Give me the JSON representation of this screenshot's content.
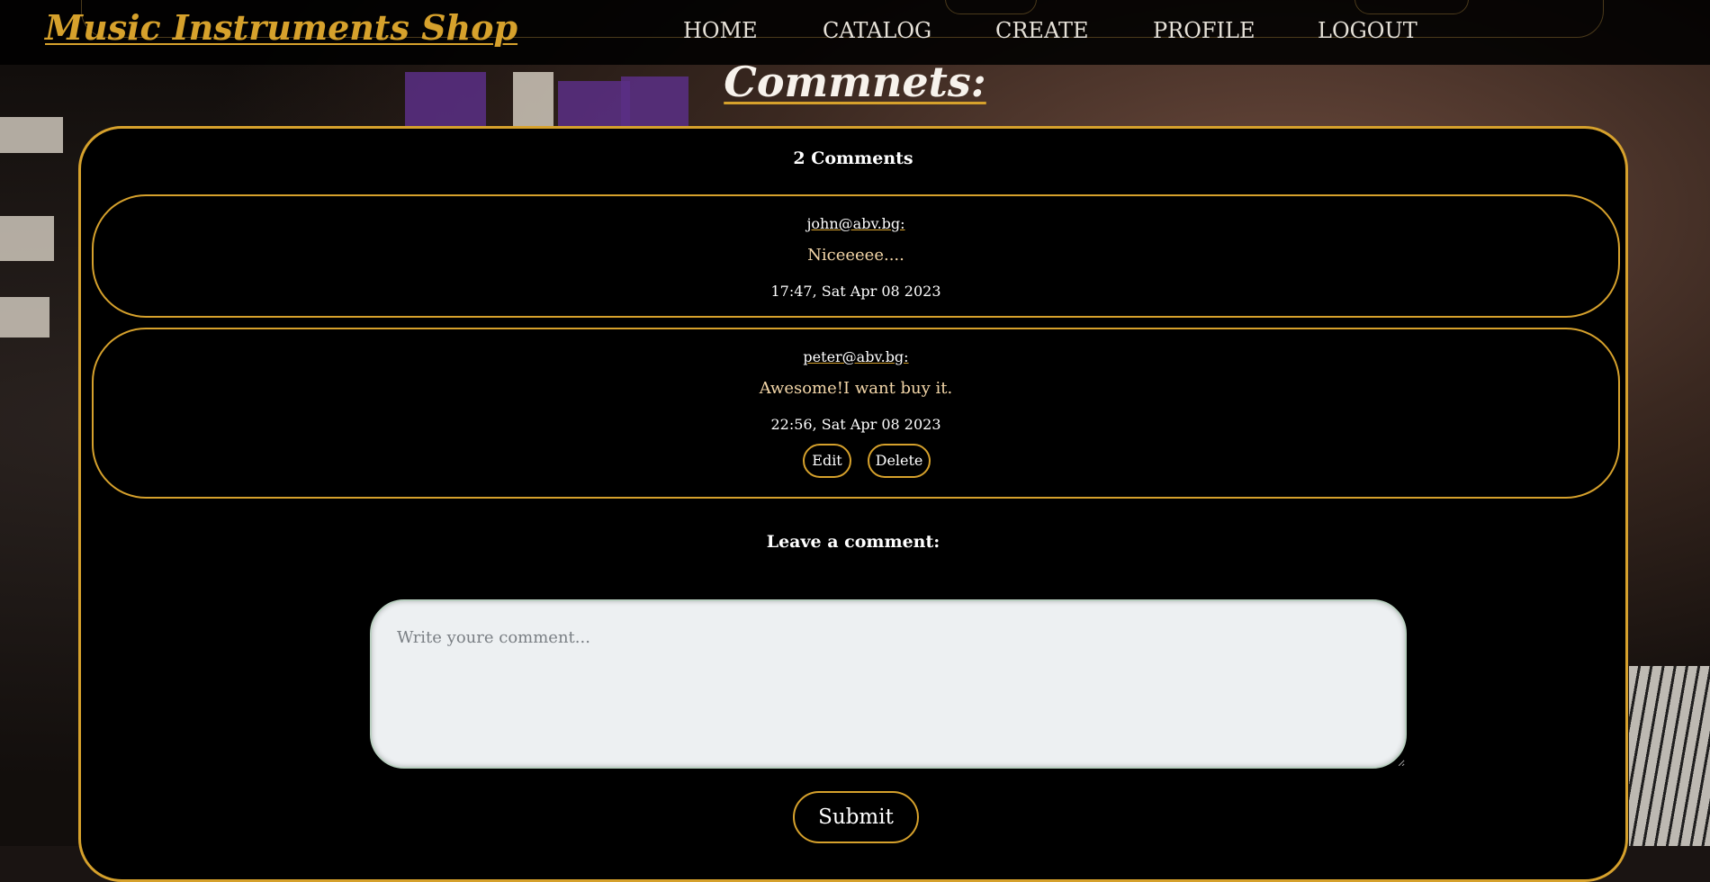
{
  "header": {
    "brand": "Music Instruments Shop",
    "nav": {
      "home": "HOME",
      "catalog": "CATALOG",
      "create": "CREATE",
      "profile": "PROFILE",
      "logout": "LOGOUT"
    }
  },
  "page": {
    "title": "Commnets:"
  },
  "comments": {
    "count_label": "2 Comments",
    "items": [
      {
        "author": "john@abv.bg:",
        "text": "Niceeeee....",
        "time": "17:47, Sat Apr 08 2023"
      },
      {
        "author": "peter@abv.bg:",
        "text": "Awesome!I want buy it.",
        "time": "22:56, Sat Apr 08 2023",
        "edit_label": "Edit",
        "delete_label": "Delete"
      }
    ]
  },
  "form": {
    "heading": "Leave a comment:",
    "placeholder": "Write youre comment...",
    "value": "",
    "submit_label": "Submit"
  },
  "colors": {
    "accent": "#d6a12c",
    "panel_bg": "#000000",
    "text": "#ffffff",
    "comment_text": "#f3d6a8"
  }
}
